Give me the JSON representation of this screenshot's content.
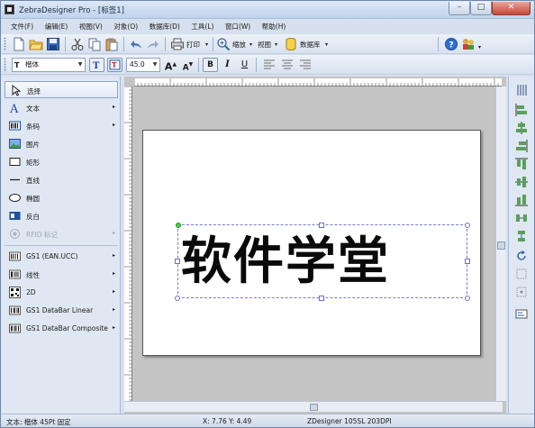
{
  "window": {
    "title": "ZebraDesigner Pro - [标签1]",
    "controls": {
      "minimize": "–",
      "maximize": "□",
      "close": "✕"
    }
  },
  "menubar": {
    "items": [
      "文件(F)",
      "编辑(E)",
      "视图(V)",
      "对象(O)",
      "数据库(D)",
      "工具(L)",
      "窗口(W)",
      "帮助(H)"
    ]
  },
  "toolbar": {
    "print_label": "打印",
    "zoom_label": "缩放",
    "view_label": "视图",
    "database_label": "数据库"
  },
  "format_toolbar": {
    "font_name": "楷体",
    "font_size": "45.0",
    "bold": "B",
    "italic": "I",
    "underline": "U",
    "grow": "A",
    "shrink": "A"
  },
  "sidebar": {
    "tools": [
      {
        "label": "选择",
        "icon": "pointer-icon"
      },
      {
        "label": "文本",
        "icon": "text-icon"
      },
      {
        "label": "条码",
        "icon": "barcode-icon"
      },
      {
        "label": "图片",
        "icon": "picture-icon"
      },
      {
        "label": "矩形",
        "icon": "rectangle-icon"
      },
      {
        "label": "直线",
        "icon": "line-icon"
      },
      {
        "label": "椭圆",
        "icon": "ellipse-icon"
      },
      {
        "label": "反白",
        "icon": "inverse-icon"
      },
      {
        "label": "RFID 标记",
        "icon": "rfid-icon"
      },
      {
        "label": "GS1 (EAN.UCC)",
        "icon": "gs1-icon"
      },
      {
        "label": "线性",
        "icon": "linear-barcode-icon"
      },
      {
        "label": "2D",
        "icon": "2d-barcode-icon"
      },
      {
        "label": "GS1 DataBar Linear",
        "icon": "gs1-databar-icon"
      },
      {
        "label": "GS1 DataBar Composite",
        "icon": "gs1-composite-icon"
      }
    ]
  },
  "canvas": {
    "label_text": "软件学堂"
  },
  "statusbar": {
    "font_info": "文本: 楷体 45Pt 固定",
    "coords": "X:  7.76 Y:  4.49",
    "printer": "ZDesigner 105SL 203DPI"
  },
  "colors": {
    "accent": "#3a6fc4",
    "selection": "#6b6bd0",
    "anchor": "#3ed13e"
  }
}
